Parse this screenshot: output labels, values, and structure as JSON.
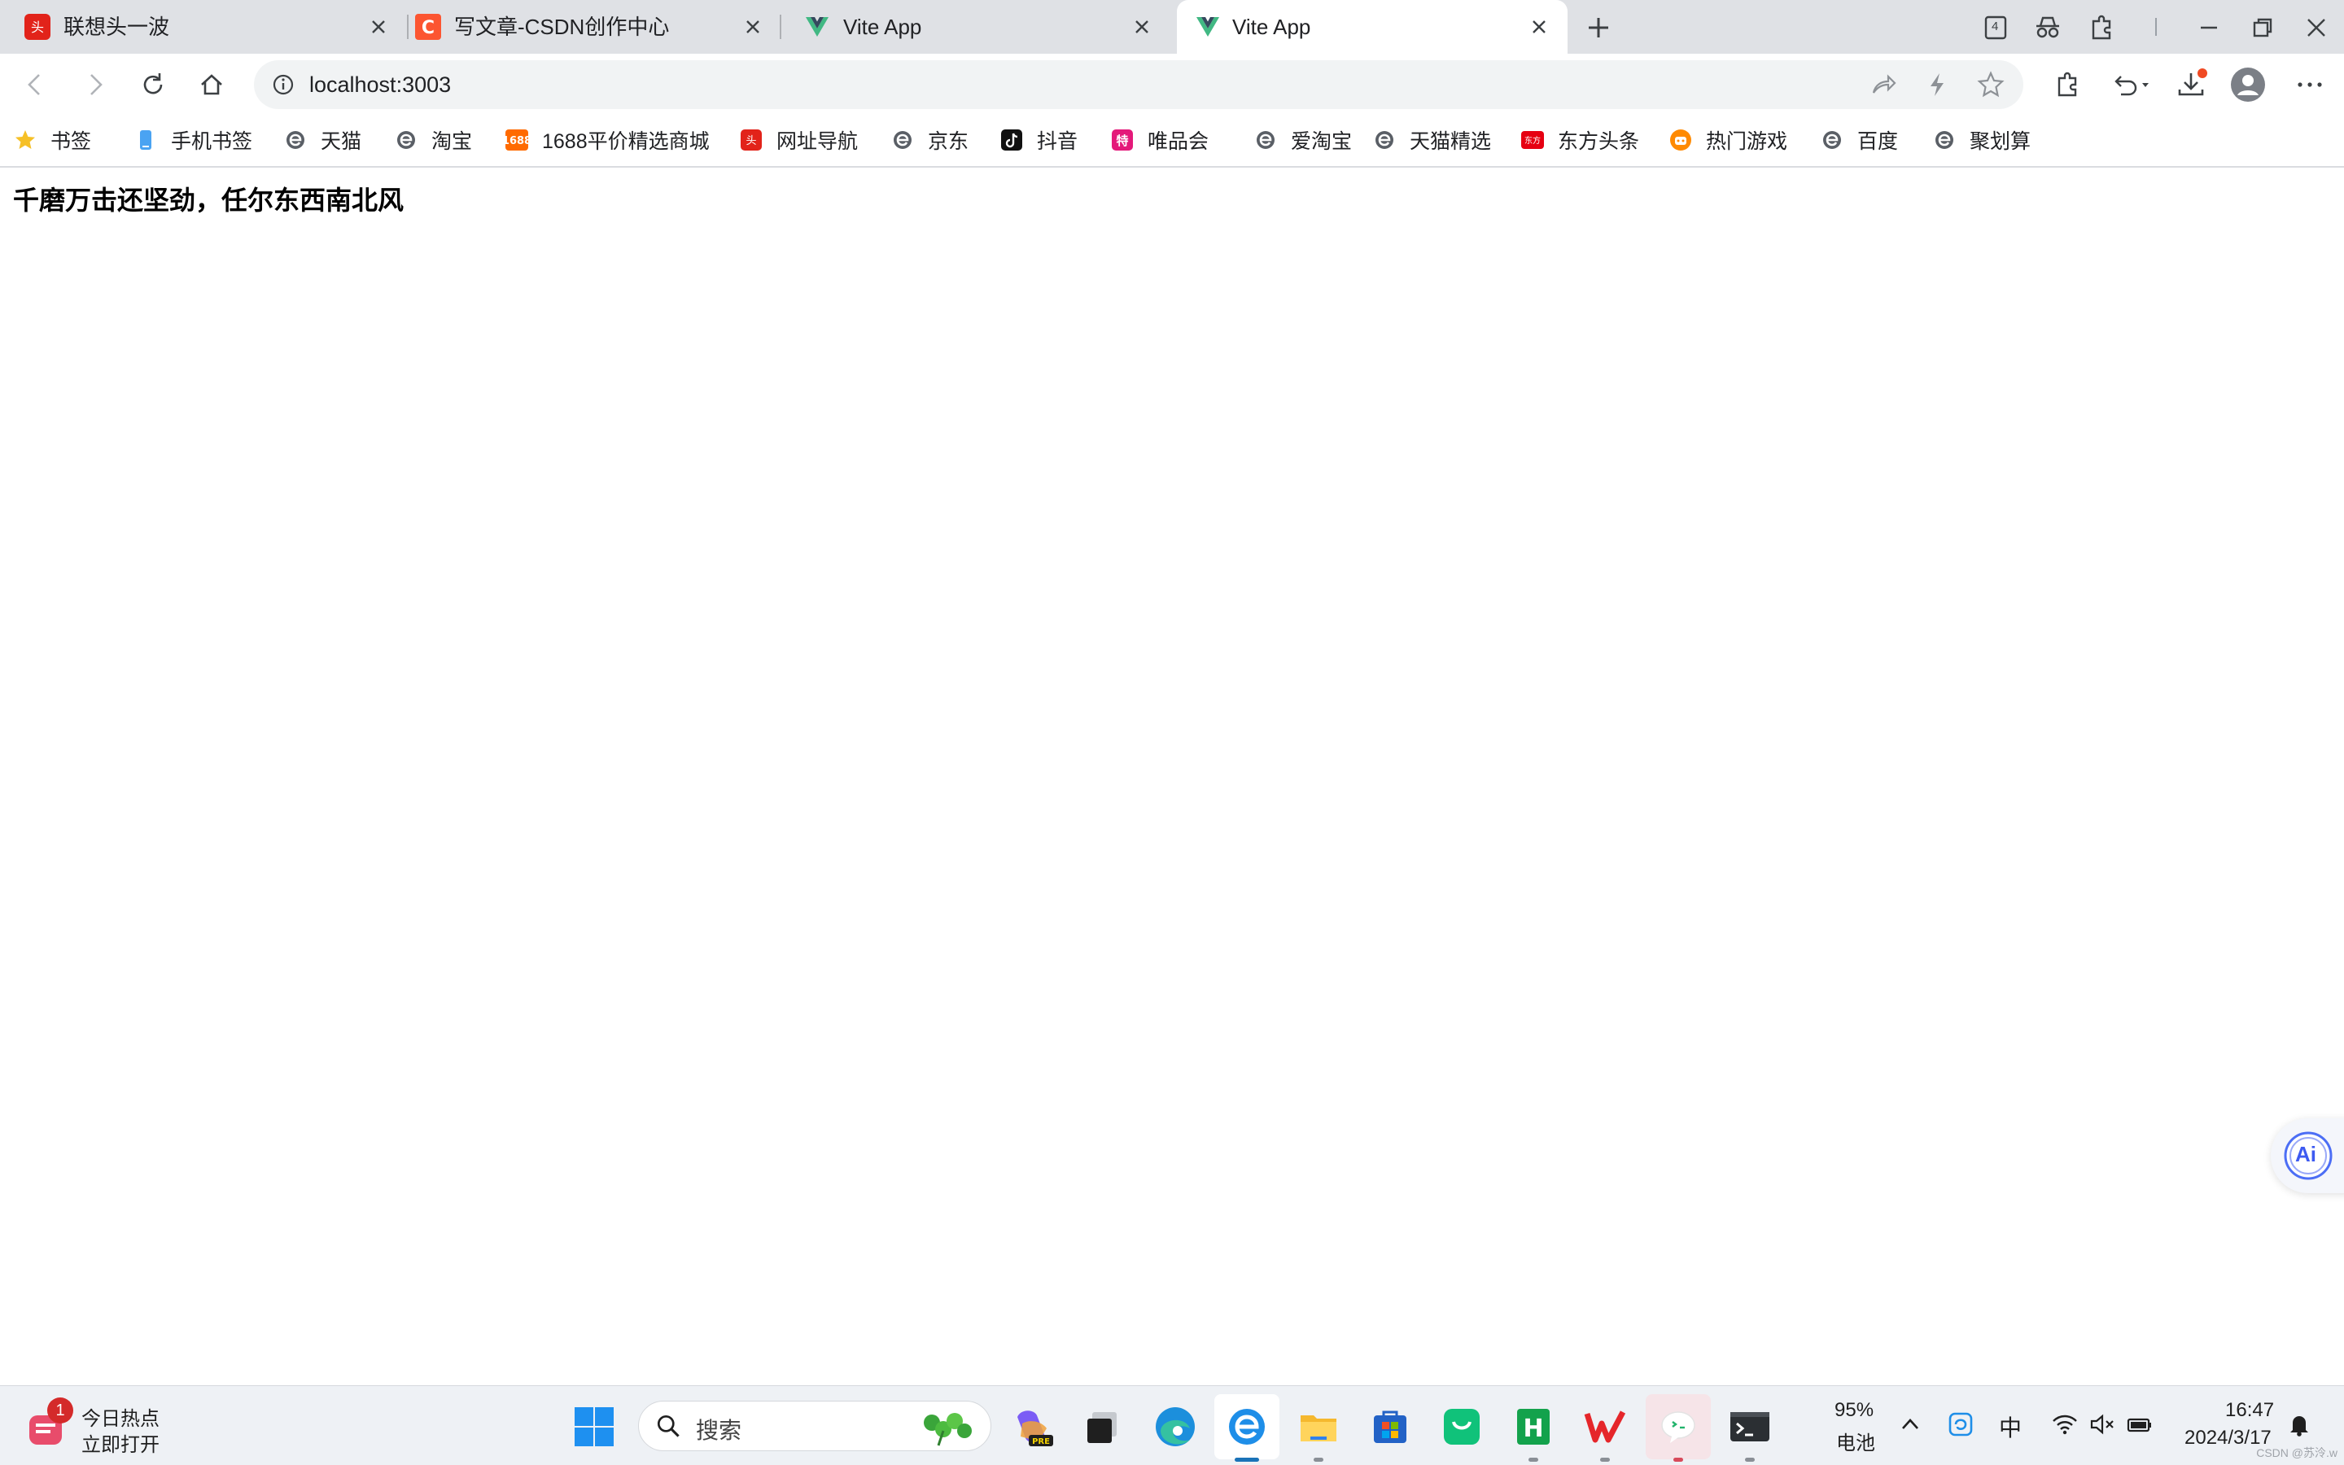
{
  "tabs": [
    {
      "title": "联想头一波",
      "active": false,
      "favicon": "lenovo-icon"
    },
    {
      "title": "写文章-CSDN创作中心",
      "active": false,
      "favicon": "csdn-icon"
    },
    {
      "title": "Vite App",
      "active": false,
      "favicon": "vue-icon"
    },
    {
      "title": "Vite App",
      "active": true,
      "favicon": "vue-icon"
    }
  ],
  "tab_strip_controls": {
    "tab_count": "4"
  },
  "address_bar": {
    "url": "localhost:3003"
  },
  "bookmarks": [
    {
      "label": "书签",
      "icon": "star-icon"
    },
    {
      "label": "手机书签",
      "icon": "phone-icon"
    },
    {
      "label": "天猫",
      "icon": "ie-icon"
    },
    {
      "label": "淘宝",
      "icon": "ie-icon"
    },
    {
      "label": "1688平价精选商城",
      "icon": "alibaba-icon"
    },
    {
      "label": "网址导航",
      "icon": "lenovo-icon"
    },
    {
      "label": "京东",
      "icon": "ie-icon"
    },
    {
      "label": "抖音",
      "icon": "douyin-icon"
    },
    {
      "label": "唯品会",
      "icon": "vip-icon"
    },
    {
      "label": "爱淘宝",
      "icon": "ie-icon"
    },
    {
      "label": "天猫精选",
      "icon": "ie-icon"
    },
    {
      "label": "东方头条",
      "icon": "dongfang-icon"
    },
    {
      "label": "热门游戏",
      "icon": "game-icon"
    },
    {
      "label": "百度",
      "icon": "ie-icon"
    },
    {
      "label": "聚划算",
      "icon": "ie-icon"
    }
  ],
  "page": {
    "heading": "千磨万击还坚劲，任尔东西南北风",
    "float_button": "Ai"
  },
  "taskbar": {
    "news": {
      "badge": "1",
      "title": "今日热点",
      "subtitle": "立即打开"
    },
    "search_placeholder": "搜索",
    "battery_percent": "95%",
    "battery_label": "电池",
    "ime": "中",
    "time": "16:47",
    "date": "2024/3/17",
    "watermark": "CSDN @苏泠.w"
  },
  "colors": {
    "accent": "#1a73e8",
    "csdn_red": "#fc5531",
    "vue_green": "#41b883",
    "lenovo_red": "#e2231a"
  }
}
